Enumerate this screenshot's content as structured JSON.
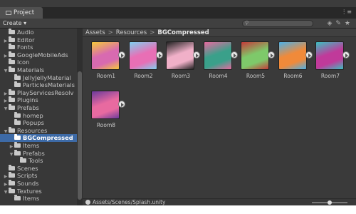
{
  "window": {
    "tab_title": "Project"
  },
  "toolbar": {
    "create_label": "Create"
  },
  "tree": [
    {
      "label": "Audio",
      "indent": 1,
      "arrow": ""
    },
    {
      "label": "Editor",
      "indent": 1,
      "arrow": "▶"
    },
    {
      "label": "Fonts",
      "indent": 1,
      "arrow": ""
    },
    {
      "label": "GoogleMobileAds",
      "indent": 1,
      "arrow": "▶"
    },
    {
      "label": "Icon",
      "indent": 1,
      "arrow": ""
    },
    {
      "label": "Materials",
      "indent": 1,
      "arrow": "▼"
    },
    {
      "label": "JellyJellyMaterial",
      "indent": 2,
      "arrow": ""
    },
    {
      "label": "ParticlesMaterials",
      "indent": 2,
      "arrow": ""
    },
    {
      "label": "PlayServicesResolv",
      "indent": 1,
      "arrow": "▶"
    },
    {
      "label": "Plugins",
      "indent": 1,
      "arrow": "▶"
    },
    {
      "label": "Prefabs",
      "indent": 1,
      "arrow": "▼"
    },
    {
      "label": "homep",
      "indent": 2,
      "arrow": ""
    },
    {
      "label": "Popups",
      "indent": 2,
      "arrow": ""
    },
    {
      "label": "Resources",
      "indent": 1,
      "arrow": "▼"
    },
    {
      "label": "BGCompressed",
      "indent": 2,
      "arrow": "",
      "selected": true
    },
    {
      "label": "Items",
      "indent": 2,
      "arrow": "▶"
    },
    {
      "label": "Prefabs",
      "indent": 2,
      "arrow": "▼"
    },
    {
      "label": "Tools",
      "indent": 3,
      "arrow": ""
    },
    {
      "label": "Scenes",
      "indent": 1,
      "arrow": ""
    },
    {
      "label": "Scripts",
      "indent": 1,
      "arrow": "▶"
    },
    {
      "label": "Sounds",
      "indent": 1,
      "arrow": "▶"
    },
    {
      "label": "Textures",
      "indent": 1,
      "arrow": "▼"
    },
    {
      "label": "Items",
      "indent": 2,
      "arrow": ""
    }
  ],
  "breadcrumb": {
    "part1": "Assets",
    "part2": "Resources",
    "current": "BGCompressed"
  },
  "assets": [
    {
      "label": "Room1",
      "bg": "#d86ab0",
      "accent": "#f4c93a"
    },
    {
      "label": "Room2",
      "bg": "#e86fb5",
      "accent": "#7fd0f0"
    },
    {
      "label": "Room3",
      "bg": "#f0b0c8",
      "accent": "#222222"
    },
    {
      "label": "Room4",
      "bg": "#3aa08a",
      "accent": "#e86aa0"
    },
    {
      "label": "Room5",
      "bg": "#7ec96a",
      "accent": "#c53a3a"
    },
    {
      "label": "Room6",
      "bg": "#f08a3a",
      "accent": "#4ab0e8"
    },
    {
      "label": "Room7",
      "bg": "#c03a9a",
      "accent": "#3ac0c0"
    },
    {
      "label": "Room8",
      "bg": "#e86aa0",
      "accent": "#6a3a9a"
    }
  ],
  "status": {
    "path": "Assets/Scenes/Splash.unity"
  }
}
